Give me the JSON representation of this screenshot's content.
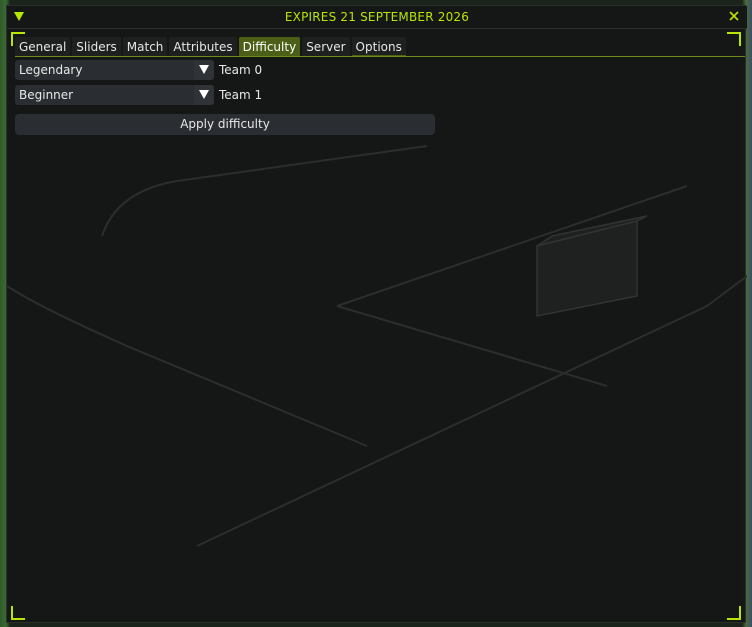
{
  "window": {
    "title": "EXPIRES 21 SEPTEMBER 2026",
    "accent_color": "#b8e600",
    "icons": {
      "collapse": "triangle-down-icon",
      "close": "close-icon"
    }
  },
  "tabs": [
    {
      "label": "General"
    },
    {
      "label": "Sliders"
    },
    {
      "label": "Match"
    },
    {
      "label": "Attributes"
    },
    {
      "label": "Difficulty",
      "active": true
    },
    {
      "label": "Server"
    },
    {
      "label": "Options"
    }
  ],
  "difficulty": {
    "team0": {
      "selected": "Legendary",
      "label": "Team 0"
    },
    "team1": {
      "selected": "Beginner",
      "label": "Team 1"
    },
    "apply_label": "Apply difficulty"
  }
}
